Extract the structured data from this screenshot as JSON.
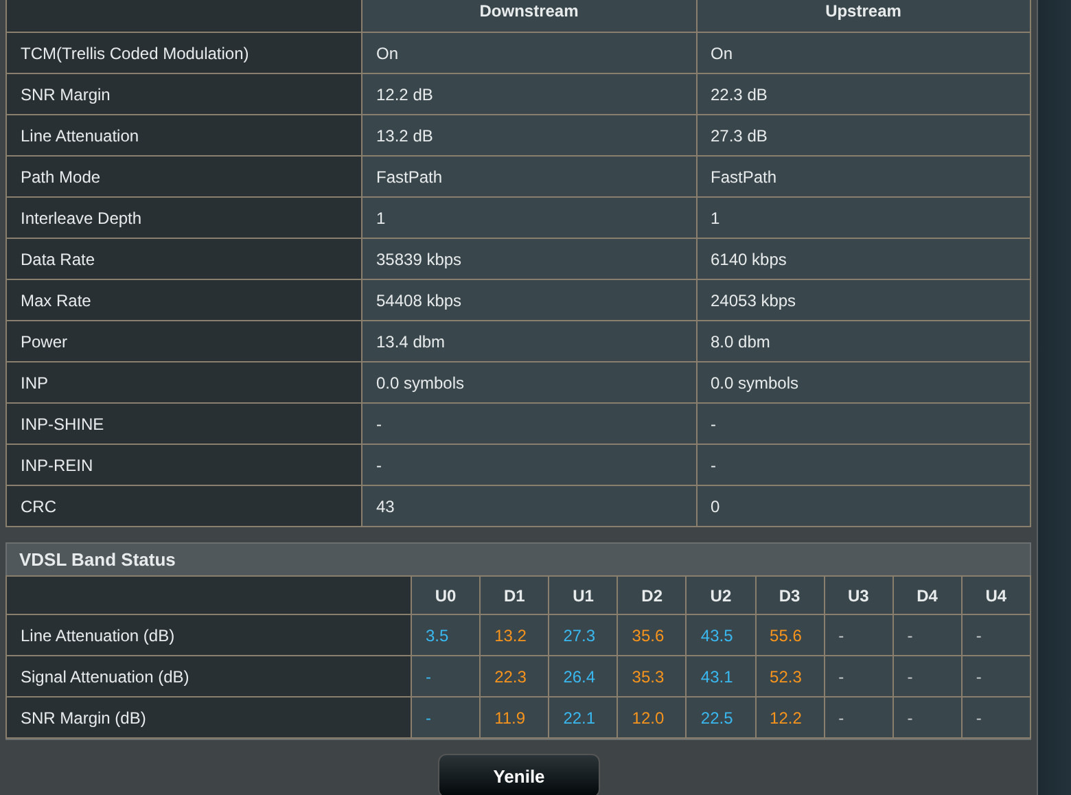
{
  "dsl_table": {
    "columns": [
      "Downstream",
      "Upstream"
    ],
    "rows": [
      {
        "label": "TCM(Trellis Coded Modulation)",
        "values": [
          "On",
          "On"
        ]
      },
      {
        "label": "SNR Margin",
        "values": [
          "12.2 dB",
          "22.3 dB"
        ]
      },
      {
        "label": "Line Attenuation",
        "values": [
          "13.2 dB",
          "27.3 dB"
        ]
      },
      {
        "label": "Path Mode",
        "values": [
          "FastPath",
          "FastPath"
        ]
      },
      {
        "label": "Interleave Depth",
        "values": [
          "1",
          "1"
        ]
      },
      {
        "label": "Data Rate",
        "values": [
          "35839 kbps",
          "6140 kbps"
        ]
      },
      {
        "label": "Max Rate",
        "values": [
          "54408 kbps",
          "24053 kbps"
        ]
      },
      {
        "label": "Power",
        "values": [
          "13.4 dbm",
          "8.0 dbm"
        ]
      },
      {
        "label": "INP",
        "values": [
          "0.0 symbols",
          "0.0 symbols"
        ]
      },
      {
        "label": "INP-SHINE",
        "values": [
          "-",
          "-"
        ]
      },
      {
        "label": "INP-REIN",
        "values": [
          "-",
          "-"
        ]
      },
      {
        "label": "CRC",
        "values": [
          "43",
          "0"
        ]
      }
    ]
  },
  "band_status": {
    "title": "VDSL Band Status",
    "columns": [
      {
        "label": "U0",
        "color": "#3ab8f0"
      },
      {
        "label": "D1",
        "color": "#f7941d"
      },
      {
        "label": "U1",
        "color": "#3ab8f0"
      },
      {
        "label": "D2",
        "color": "#f7941d"
      },
      {
        "label": "U2",
        "color": "#3ab8f0"
      },
      {
        "label": "D3",
        "color": "#f7941d"
      },
      {
        "label": "U3",
        "color": "#c8cccd"
      },
      {
        "label": "D4",
        "color": "#c8cccd"
      },
      {
        "label": "U4",
        "color": "#c8cccd"
      }
    ],
    "rows": [
      {
        "label": "Line Attenuation (dB)",
        "values": [
          "3.5",
          "13.2",
          "27.3",
          "35.6",
          "43.5",
          "55.6",
          "-",
          "-",
          "-"
        ]
      },
      {
        "label": "Signal Attenuation (dB)",
        "values": [
          "-",
          "22.3",
          "26.4",
          "35.3",
          "43.1",
          "52.3",
          "-",
          "-",
          "-"
        ]
      },
      {
        "label": "SNR Margin (dB)",
        "values": [
          "-",
          "11.9",
          "22.1",
          "12.0",
          "22.5",
          "12.2",
          "-",
          "-",
          "-"
        ]
      }
    ]
  },
  "buttons": [
    "Yenile"
  ]
}
